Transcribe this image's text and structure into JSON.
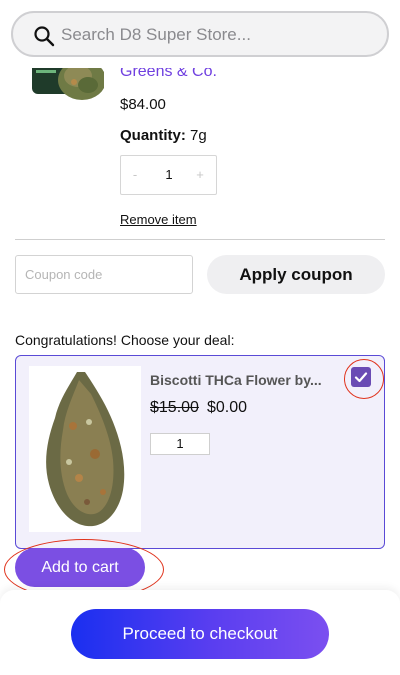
{
  "search": {
    "placeholder": "Search D8 Super Store..."
  },
  "cart_item": {
    "brand": "Greens & Co.",
    "price": "$84.00",
    "quantity_label": "Quantity:",
    "quantity_value": " 7g",
    "stepper": {
      "minus": "-",
      "value": "1",
      "plus": "+"
    },
    "remove_label": "Remove item"
  },
  "coupon": {
    "placeholder": "Coupon code",
    "apply_label": "Apply coupon"
  },
  "deal": {
    "heading": "Congratulations! Choose your deal:",
    "title": "Biscotti THCa Flower by...",
    "old_price": "$15.00",
    "new_price": "$0.00",
    "quantity": "1",
    "checked": true,
    "add_label": "Add to cart"
  },
  "checkout": {
    "label": "Proceed to checkout"
  },
  "colors": {
    "accent": "#7b4fe3",
    "brand_link": "#6f3fe0",
    "annotation": "#e0331c",
    "check": "#6a4bb4"
  },
  "icons": {
    "search": "search-icon",
    "check": "check-icon"
  }
}
